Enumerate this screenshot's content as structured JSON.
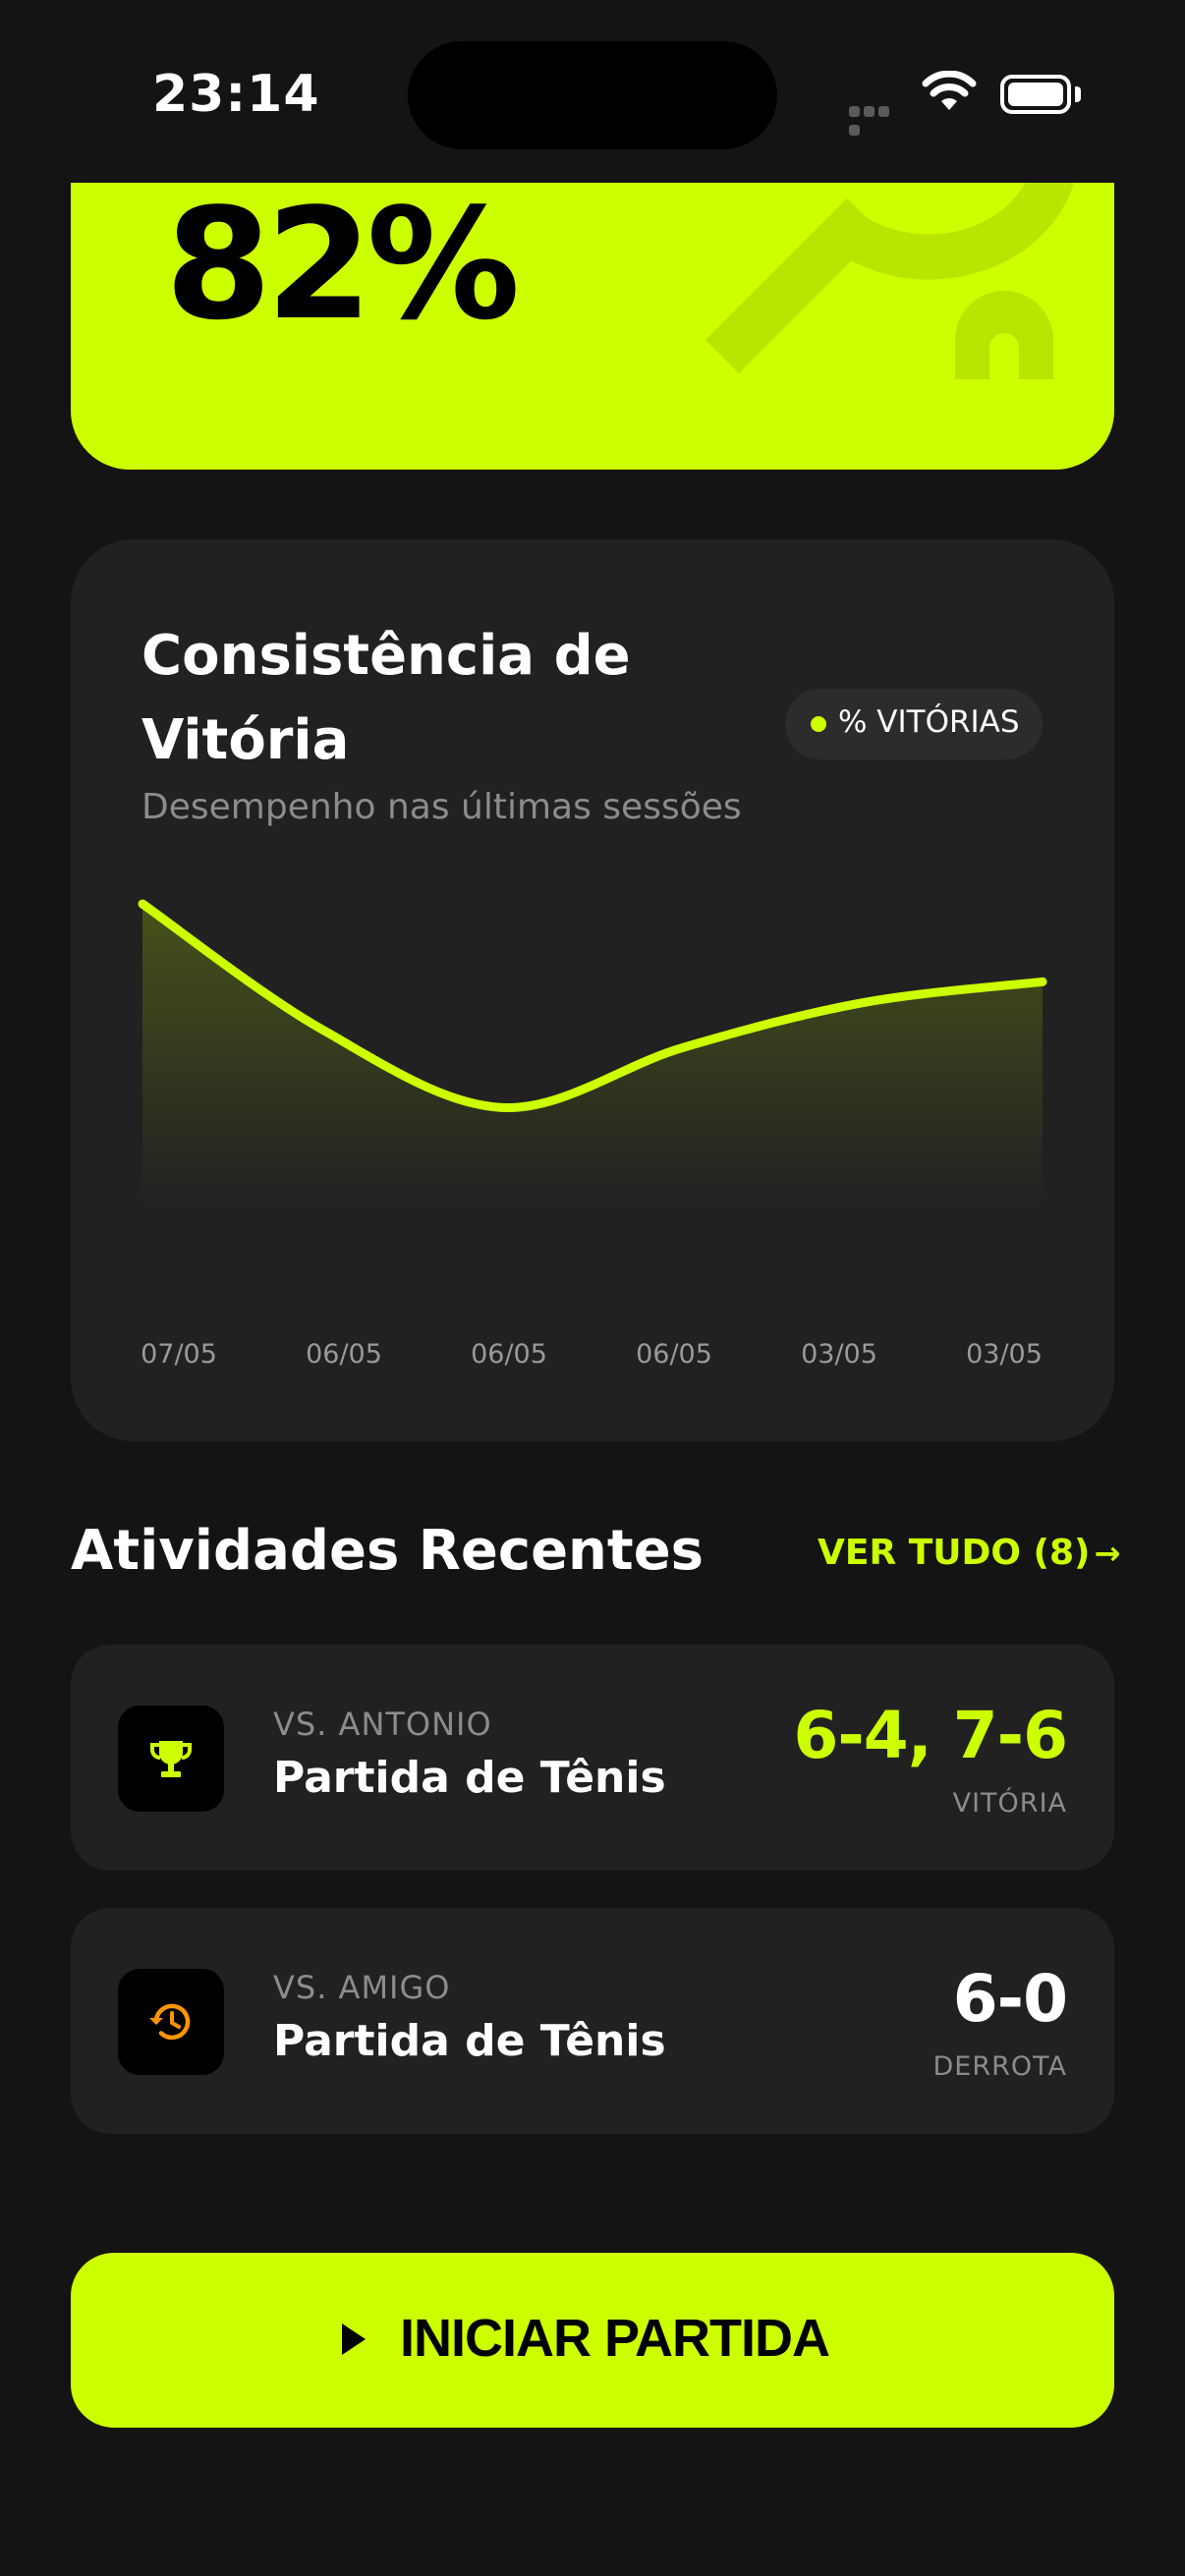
{
  "status_bar": {
    "time": "23:14"
  },
  "hero": {
    "value": "82%"
  },
  "consistency": {
    "title": "Consistência de Vitória",
    "subtitle": "Desempenho nas últimas sessões",
    "legend": "% VITÓRIAS",
    "accent_color": "#ccff00"
  },
  "chart_data": {
    "type": "area",
    "categories": [
      "07/05",
      "06/05",
      "06/05",
      "06/05",
      "03/05",
      "03/05"
    ],
    "series": [
      {
        "name": "% VITÓRIAS",
        "values": [
          100,
          58,
          32,
          52,
          67,
          74
        ]
      }
    ],
    "ylim": [
      0,
      120
    ],
    "grid": false
  },
  "recent": {
    "title": "Atividades Recentes",
    "see_all": "VER TUDO (8)",
    "see_all_arrow": "→",
    "items": [
      {
        "opponent": "VS. ANTONIO",
        "name": "Partida de Tênis",
        "score": "6-4, 7-6",
        "result": "VITÓRIA",
        "icon": "trophy-icon",
        "score_color": "#ccff00",
        "icon_color": "#ccff00"
      },
      {
        "opponent": "VS. AMIGO",
        "name": "Partida de Tênis",
        "score": "6-0",
        "result": "DERROTA",
        "icon": "history-icon",
        "score_color": "#ffffff",
        "icon_color": "#ff9500"
      }
    ]
  },
  "cta": {
    "label": "INICIAR PARTIDA"
  }
}
